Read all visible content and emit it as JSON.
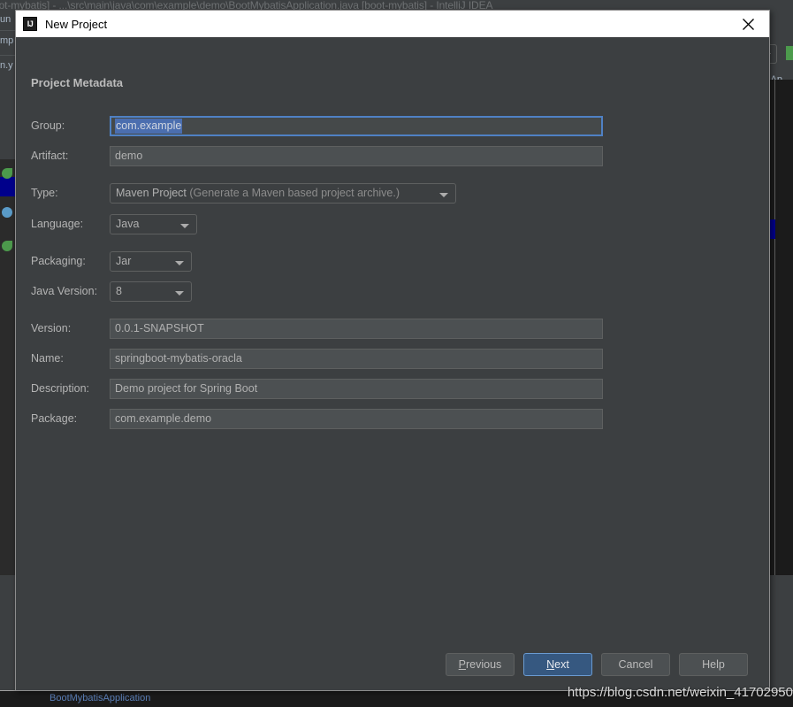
{
  "ide_background": {
    "window_title": "oot-mybatis] - ...\\src\\main\\java\\com\\example\\demo\\BootMybatisApplication.java [boot-mybatis] - IntelliJ IDEA",
    "tree_fragments": [
      "un",
      "mp",
      "n.y"
    ],
    "editor_tab_fragment": "tisAp",
    "bottom_fragment": "BootMybatisApplication"
  },
  "dialog": {
    "title": "New Project",
    "app_icon": "IJ",
    "close_icon": "close-icon",
    "section_title": "Project Metadata",
    "fields": {
      "group": {
        "label": "Group:",
        "value": "com.example",
        "selected": true,
        "focused": true
      },
      "artifact": {
        "label": "Artifact:",
        "value": "demo"
      },
      "type": {
        "label": "Type:",
        "value": "Maven Project",
        "hint": "(Generate a Maven based project archive.)"
      },
      "language": {
        "label": "Language:",
        "value": "Java"
      },
      "packaging": {
        "label": "Packaging:",
        "value": "Jar"
      },
      "java_version": {
        "label": "Java Version:",
        "value": "8"
      },
      "version": {
        "label": "Version:",
        "value": "0.0.1-SNAPSHOT"
      },
      "name": {
        "label": "Name:",
        "value": "springboot-mybatis-oracla"
      },
      "description": {
        "label": "Description:",
        "value": "Demo project for Spring Boot"
      },
      "package": {
        "label": "Package:",
        "value": "com.example.demo"
      }
    },
    "buttons": {
      "previous": {
        "prefix": "P",
        "rest": "revious"
      },
      "next": {
        "prefix": "N",
        "rest": "ext"
      },
      "cancel": "Cancel",
      "help": "Help"
    }
  },
  "watermark": "https://blog.csdn.net/weixin_41702950",
  "colors": {
    "dialog_background": "#3C3F41",
    "input_background": "#4C5052",
    "focus_border": "#4F81C4",
    "selection": "#4B6EAF",
    "default_button": "#365880",
    "title_bar": "#FFFFFF"
  }
}
